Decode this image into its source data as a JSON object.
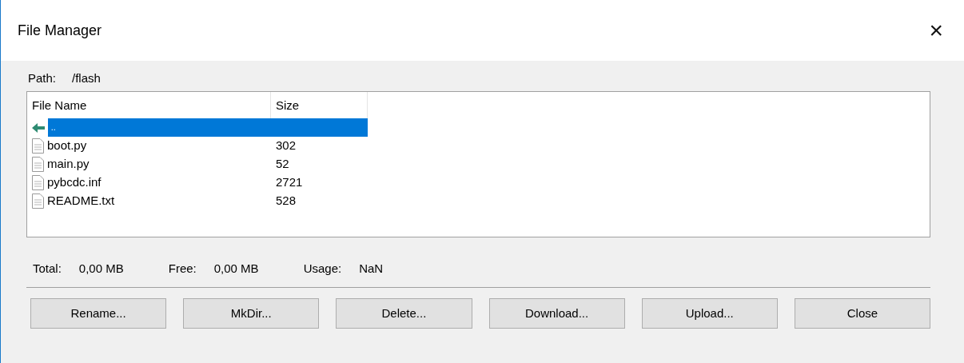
{
  "window": {
    "title": "File Manager",
    "close": "×"
  },
  "path": {
    "label": "Path:",
    "value": "/flash"
  },
  "table": {
    "columns": [
      "File Name",
      "Size"
    ],
    "rows": [
      {
        "kind": "parent",
        "name": "..",
        "size": "",
        "selected": true
      },
      {
        "kind": "file",
        "name": "boot.py",
        "size": "302",
        "selected": false
      },
      {
        "kind": "file",
        "name": "main.py",
        "size": "52",
        "selected": false
      },
      {
        "kind": "file",
        "name": "pybcdc.inf",
        "size": "2721",
        "selected": false
      },
      {
        "kind": "file",
        "name": "README.txt",
        "size": "528",
        "selected": false
      }
    ]
  },
  "stats": [
    {
      "label": "Total:",
      "value": "0,00 MB"
    },
    {
      "label": "Free:",
      "value": "0,00 MB"
    },
    {
      "label": "Usage:",
      "value": "NaN"
    }
  ],
  "buttons": [
    "Rename...",
    "MkDir...",
    "Delete...",
    "Download...",
    "Upload...",
    "Close"
  ]
}
